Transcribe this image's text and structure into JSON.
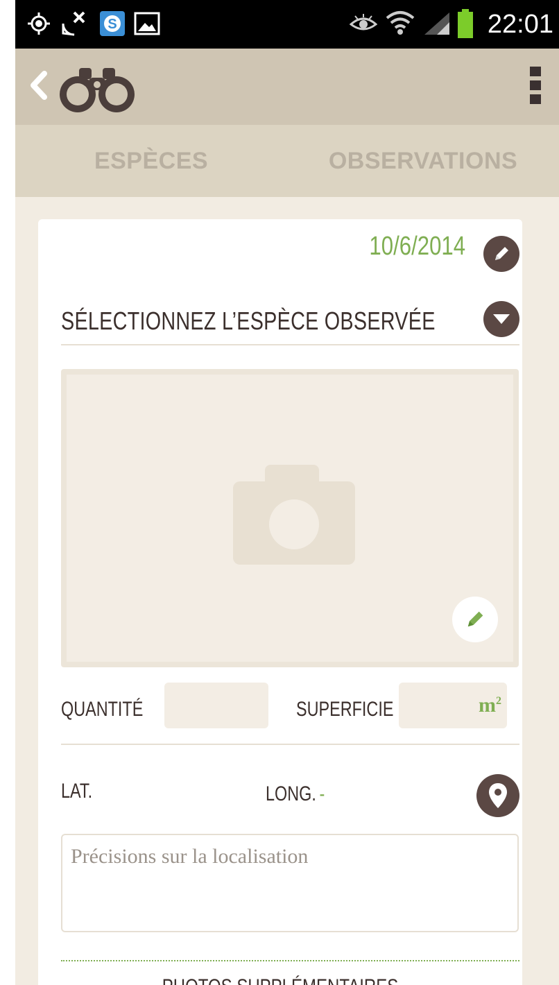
{
  "status_bar": {
    "time": "22:01",
    "icons": [
      "gps-icon",
      "no-signal-icon",
      "app-s-icon",
      "image-icon",
      "eye-icon",
      "wifi-icon",
      "cell-signal-icon",
      "battery-icon"
    ]
  },
  "app_bar": {
    "back_icon": "chevron-left-icon",
    "logo_icon": "binoculars-icon",
    "menu_icon": "overflow-menu-icon"
  },
  "tabs": [
    {
      "label": "ESPÈCES"
    },
    {
      "label": "OBSERVATIONS"
    }
  ],
  "form": {
    "date": "10/6/2014",
    "species_placeholder": "SÉLECTIONNEZ L’ESPÈCE OBSERVÉE",
    "quantity_label": "QUANTITÉ",
    "quantity_value": "",
    "area_label": "SUPERFICIE",
    "area_unit": "m",
    "area_unit_sup": "2",
    "lat_label": "LAT.",
    "long_label": "LONG.",
    "long_value": "-",
    "location_placeholder": "Précisions sur la localisation",
    "more_photos_label": "PHOTOS SUPPLÉMENTAIRES"
  },
  "colors": {
    "accent_green": "#7fae52",
    "dark_brown": "#5b4844",
    "background": "#f2ece2",
    "app_bar": "#cfc5b3"
  }
}
